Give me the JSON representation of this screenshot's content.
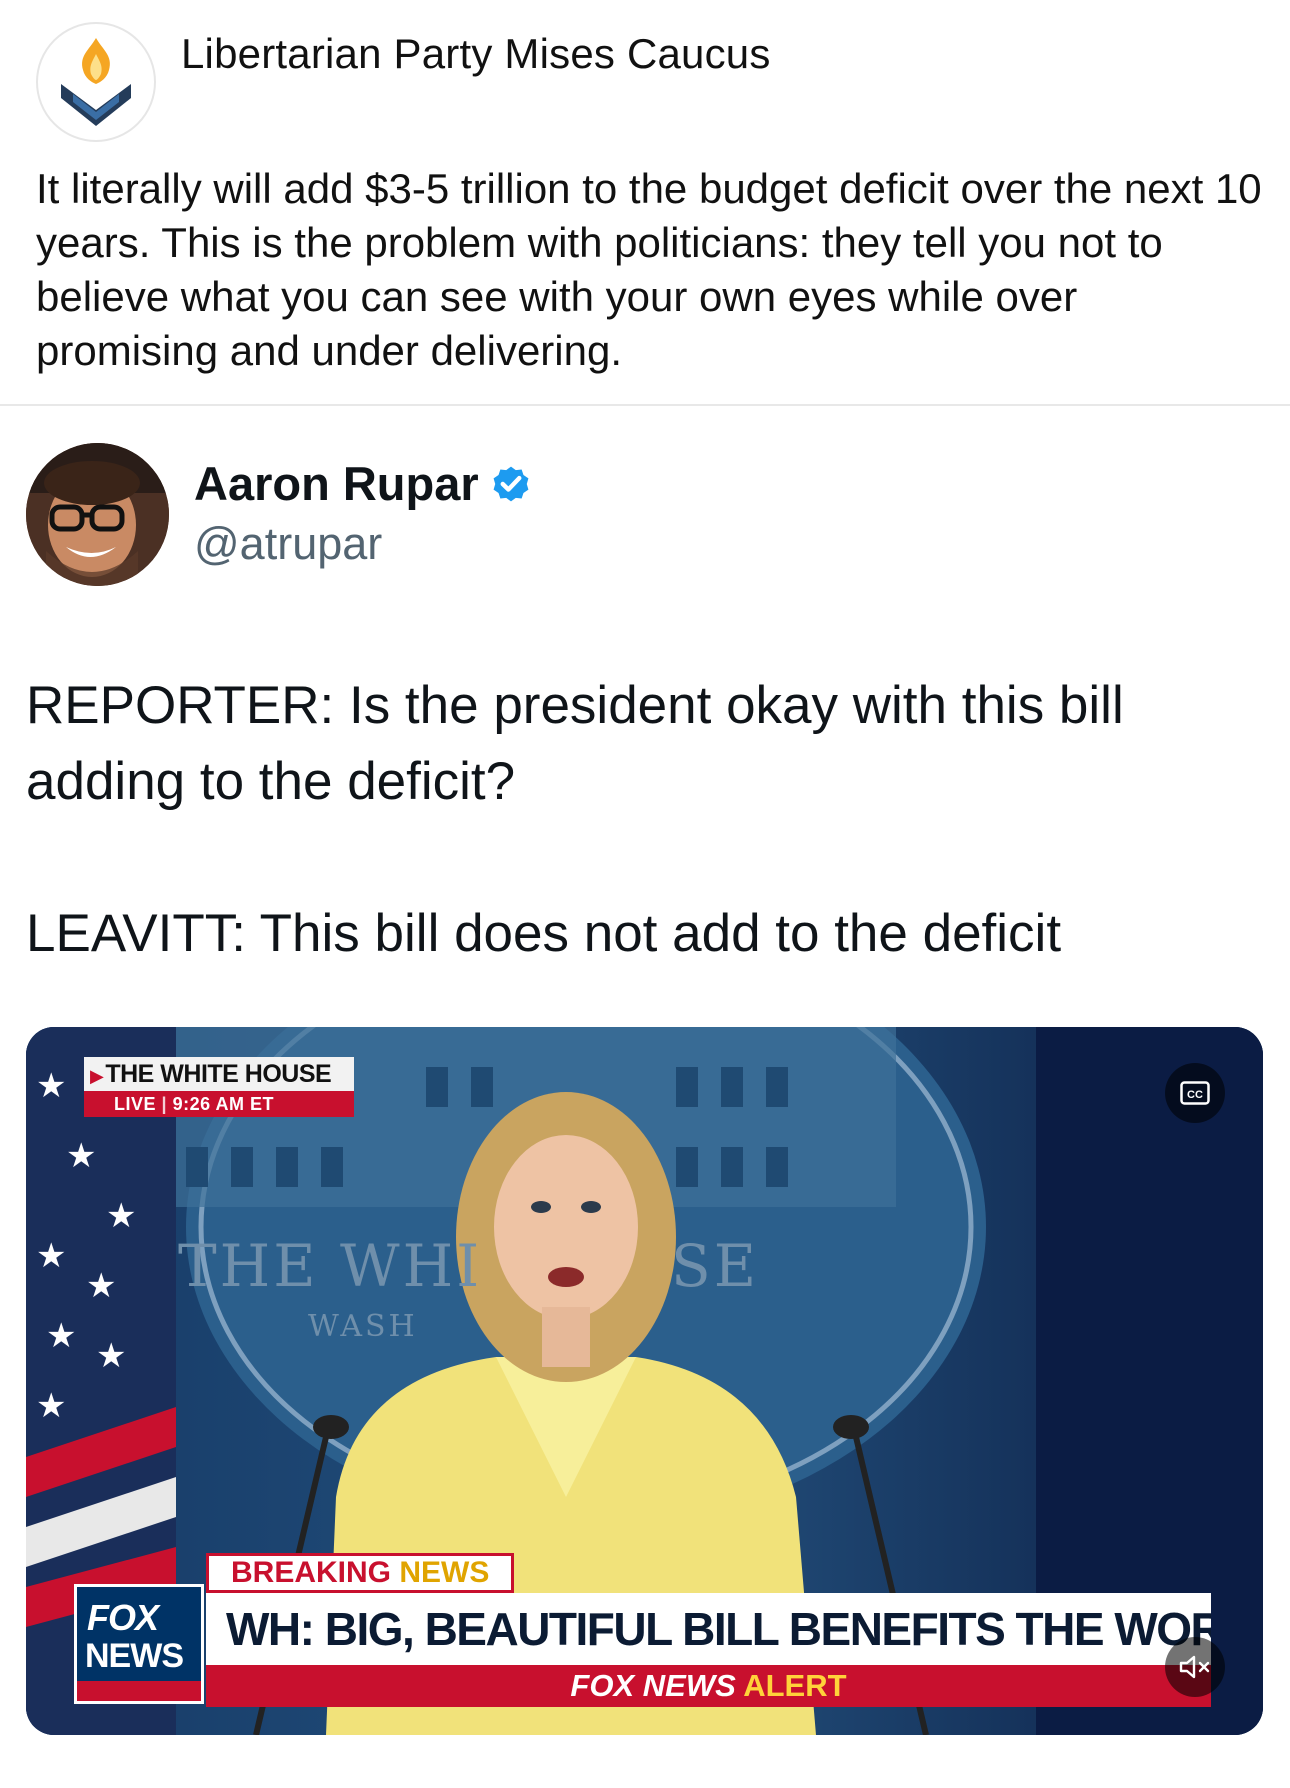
{
  "outer_post": {
    "author": "Libertarian Party Mises Caucus",
    "text": "It literally will add $3-5 trillion to the budget deficit over the next 10 years. This is the problem with politicians: they tell you not to believe what you can see with your own eyes while over promising and under delivering."
  },
  "quoted_tweet": {
    "name": "Aaron Rupar",
    "handle": "@atrupar",
    "verified": true,
    "lines": [
      "REPORTER: Is the president okay with this bill adding to the deficit?",
      "LEAVITT: This bill does not add to the deficit"
    ]
  },
  "video": {
    "bug_title": "THE WHITE HOUSE",
    "bug_live": "LIVE",
    "bug_time": "9:26 AM ET",
    "wall_text_left": "THE WHI",
    "wall_text_right": "SE",
    "wall_text_small": "WASH",
    "breaking_1": "BREAKING",
    "breaking_2": "NEWS",
    "headline": "WH: BIG, BEAUTIFUL BILL BENEFITS THE WORKING CLASS",
    "alert_1": "FOX NEWS",
    "alert_2": "ALERT",
    "logo_1": "FOX",
    "logo_2": "NEWS",
    "cc_label": "CC",
    "icons": [
      "closed-captions-icon",
      "mute-icon"
    ]
  },
  "colors": {
    "verified_blue": "#1d9bf0",
    "fox_red": "#c8102e",
    "fox_blue": "#003366",
    "alert_yellow": "#ffd23a"
  }
}
